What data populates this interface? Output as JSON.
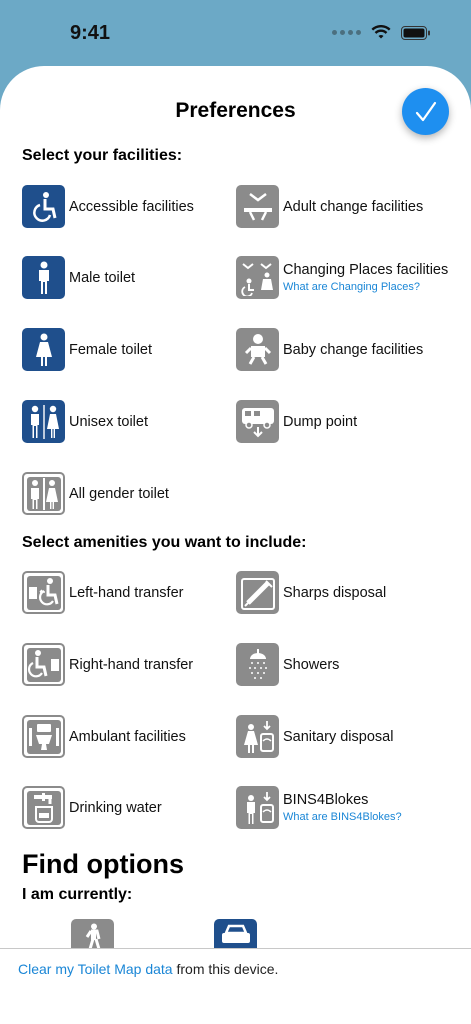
{
  "status_bar": {
    "time": "9:41"
  },
  "header": {
    "title": "Preferences",
    "done_icon": "checkmark-icon"
  },
  "facilities": {
    "heading": "Select your facilities:",
    "items": [
      {
        "label": "Accessible facilities",
        "icon": "wheelchair-icon",
        "style": "blue"
      },
      {
        "label": "Adult change facilities",
        "icon": "changing-bench-icon",
        "style": "grey"
      },
      {
        "label": "Male toilet",
        "icon": "male-icon",
        "style": "blue"
      },
      {
        "label": "Changing Places facilities",
        "link": "What are Changing Places?",
        "icon": "changing-places-icon",
        "style": "grey"
      },
      {
        "label": "Female toilet",
        "icon": "female-icon",
        "style": "blue"
      },
      {
        "label": "Baby change facilities",
        "icon": "baby-icon",
        "style": "grey"
      },
      {
        "label": "Unisex toilet",
        "icon": "unisex-icon",
        "style": "blue"
      },
      {
        "label": "Dump point",
        "icon": "dump-point-icon",
        "style": "grey"
      },
      {
        "label": "All gender toilet",
        "icon": "all-gender-icon",
        "style": "outlined"
      }
    ]
  },
  "amenities": {
    "heading": "Select amenities you want to include:",
    "items": [
      {
        "label": "Left-hand transfer",
        "icon": "left-hand-transfer-icon",
        "style": "outlined"
      },
      {
        "label": "Sharps disposal",
        "icon": "syringe-icon",
        "style": "grey"
      },
      {
        "label": "Right-hand transfer",
        "icon": "right-hand-transfer-icon",
        "style": "outlined"
      },
      {
        "label": "Showers",
        "icon": "shower-icon",
        "style": "grey"
      },
      {
        "label": "Ambulant facilities",
        "icon": "ambulant-toilet-icon",
        "style": "outlined"
      },
      {
        "label": "Sanitary disposal",
        "icon": "sanitary-disposal-icon",
        "style": "grey"
      },
      {
        "label": "Drinking water",
        "icon": "drinking-water-icon",
        "style": "outlined"
      },
      {
        "label": "BINS4Blokes",
        "link": "What are BINS4Blokes?",
        "icon": "bins4blokes-icon",
        "style": "grey"
      }
    ]
  },
  "find_options": {
    "heading": "Find options",
    "subheading": "I am currently:",
    "options": [
      {
        "icon": "walking-icon",
        "style": "grey"
      },
      {
        "icon": "car-icon",
        "style": "blue"
      }
    ]
  },
  "footer": {
    "link_text": "Clear my Toilet Map data",
    "suffix": " from this device."
  },
  "colors": {
    "accent": "#1e8ff0",
    "blue_icon": "#1f4f8c",
    "grey_icon": "#8b8b8b",
    "link": "#1a86d6"
  }
}
